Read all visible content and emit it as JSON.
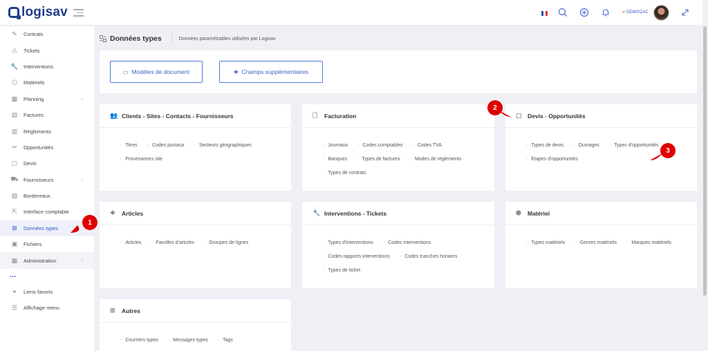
{
  "app": {
    "logo_text": "logisav"
  },
  "topbar": {
    "user": "DEMO\\ZAC"
  },
  "sidebar": {
    "items": [
      {
        "label": "Contrats",
        "icon": "contract-icon"
      },
      {
        "label": "Tickets",
        "icon": "warning-icon"
      },
      {
        "label": "Interventions",
        "icon": "wrench-icon"
      },
      {
        "label": "Matériels",
        "icon": "box-icon"
      },
      {
        "label": "Planning",
        "icon": "calendar-icon",
        "chevron": true
      },
      {
        "label": "Factures",
        "icon": "invoice-icon"
      },
      {
        "label": "Règlements",
        "icon": "payment-icon"
      },
      {
        "label": "Opportunités",
        "icon": "opportunity-icon"
      },
      {
        "label": "Devis",
        "icon": "quote-icon"
      },
      {
        "label": "Fournisseurs",
        "icon": "truck-icon",
        "chevron": true
      },
      {
        "label": "Bordereaux",
        "icon": "slip-icon"
      },
      {
        "label": "Interface comptable",
        "icon": "export-icon"
      },
      {
        "label": "Données types",
        "icon": "data-types-icon",
        "active": true
      },
      {
        "label": "Fichiers",
        "icon": "files-icon"
      },
      {
        "label": "Administration",
        "icon": "admin-icon",
        "chevron": true
      }
    ],
    "more": "...",
    "bottom": [
      {
        "label": "Liens favoris",
        "icon": "link-icon"
      },
      {
        "label": "Affichage menu",
        "icon": "menu-display-icon"
      }
    ]
  },
  "page": {
    "title": "Données types",
    "subtitle": "Données paramétrables utilisées par Logisav"
  },
  "toolbar": {
    "btn1": "Modèles de document",
    "btn2": "Champs supplémentaires"
  },
  "cards": {
    "clients": {
      "title": "Clients - Sites - Contacts - Fournisseurs",
      "links": [
        "Titres",
        "Codes postaux",
        "Secteurs géographiques",
        "Provenances site"
      ]
    },
    "facturation": {
      "title": "Facturation",
      "links": [
        "Journaux",
        "Codes comptables",
        "Codes TVA",
        "Banques",
        "Types de factures",
        "Modes de règlements",
        "Types de contrats"
      ]
    },
    "devis": {
      "title": "Devis - Opportunités",
      "links": [
        "Types de devis",
        "Ouvrages",
        "Types d'opportunités",
        "Etapes d'opportunités"
      ]
    },
    "articles": {
      "title": "Articles",
      "links": [
        "Articles",
        "Familles d'articles",
        "Groupes de lignes"
      ]
    },
    "interventions": {
      "title": "Interventions - Tickets",
      "links": [
        "Types d'interventions",
        "Codes interventions",
        "Codes rapports interventions",
        "Codes tranches horaires",
        "Types de ticket"
      ]
    },
    "materiel": {
      "title": "Matériel",
      "links": [
        "Types matériels",
        "Genres matériels",
        "Marques matériels"
      ]
    },
    "autres": {
      "title": "Autres",
      "links": [
        "Courriers types",
        "Messages types",
        "Tags"
      ]
    }
  },
  "markers": {
    "m1": "1",
    "m2": "2",
    "m3": "3"
  },
  "colors": {
    "brand": "#1f3f8a",
    "accent": "#3a64c8",
    "marker": "#e00000"
  }
}
